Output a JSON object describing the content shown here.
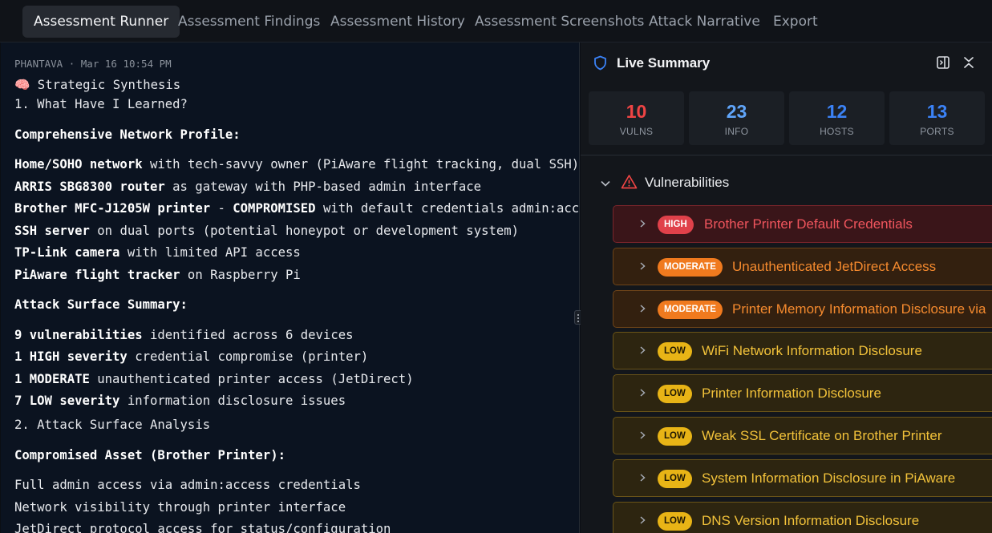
{
  "tabs": [
    {
      "label": "Assessment Runner",
      "active": true
    },
    {
      "label": "Assessment Findings",
      "active": false
    },
    {
      "label": "Assessment History",
      "active": false
    },
    {
      "label": "Assessment Screenshots",
      "active": false
    },
    {
      "label": "Attack Narrative",
      "active": false
    },
    {
      "label": "Export",
      "active": false
    }
  ],
  "message": {
    "meta": "PHANTAVA · Mar 16 10:54 PM",
    "lines": [
      {
        "emoji": "🧠",
        "text": " Strategic Synthesis"
      },
      {
        "text": "1. What Have I Learned?"
      },
      {
        "bold": "Comprehensive Network Profile:"
      },
      {
        "bold": "Home/SOHO network",
        "text": " with tech-savvy owner (PiAware flight tracking, dual SSH)"
      },
      {
        "bold": "ARRIS SBG8300 router",
        "text": " as gateway with PHP-based admin interface"
      },
      {
        "bold": "Brother MFC-J1205W printer",
        "text": " - ",
        "bold2": "COMPROMISED",
        "text2": " with default credentials admin:access"
      },
      {
        "bold": "SSH server",
        "text": " on dual ports (potential honeypot or development system)"
      },
      {
        "bold": "TP-Link camera",
        "text": " with limited API access"
      },
      {
        "bold": "PiAware flight tracker",
        "text": " on Raspberry Pi"
      },
      {
        "bold": "Attack Surface Summary:"
      },
      {
        "bold": "9 vulnerabilities",
        "text": " identified across 6 devices"
      },
      {
        "bold": "1 HIGH severity",
        "text": " credential compromise (printer)"
      },
      {
        "bold": "1 MODERATE",
        "text": " unauthenticated printer access (JetDirect)"
      },
      {
        "bold": "7 LOW severity",
        "text": " information disclosure issues"
      },
      {
        "text": "2. Attack Surface Analysis"
      },
      {
        "bold": "Compromised Asset (Brother Printer):"
      },
      {
        "text": "Full admin access via admin:access credentials"
      },
      {
        "text": "Network visibility through printer interface"
      },
      {
        "text": "JetDirect protocol access for status/configuration"
      }
    ]
  },
  "summary": {
    "title": "Live Summary",
    "stats": [
      {
        "value": "10",
        "label": "VULNS",
        "color": "#ef4444"
      },
      {
        "value": "23",
        "label": "INFO",
        "color": "#60a5fa"
      },
      {
        "value": "12",
        "label": "HOSTS",
        "color": "#3b82f6"
      },
      {
        "value": "13",
        "label": "PORTS",
        "color": "#3b82f6"
      }
    ],
    "section_title": "Vulnerabilities",
    "vulnerabilities": [
      {
        "severity": "HIGH",
        "title": "Brother Printer Default Credentials"
      },
      {
        "severity": "MODERATE",
        "title": "Unauthenticated JetDirect Access"
      },
      {
        "severity": "MODERATE",
        "title": "Printer Memory Information Disclosure via"
      },
      {
        "severity": "LOW",
        "title": "WiFi Network Information Disclosure"
      },
      {
        "severity": "LOW",
        "title": "Printer Information Disclosure"
      },
      {
        "severity": "LOW",
        "title": "Weak SSL Certificate on Brother Printer"
      },
      {
        "severity": "LOW",
        "title": "System Information Disclosure in PiAware"
      },
      {
        "severity": "LOW",
        "title": "DNS Version Information Disclosure"
      }
    ]
  }
}
